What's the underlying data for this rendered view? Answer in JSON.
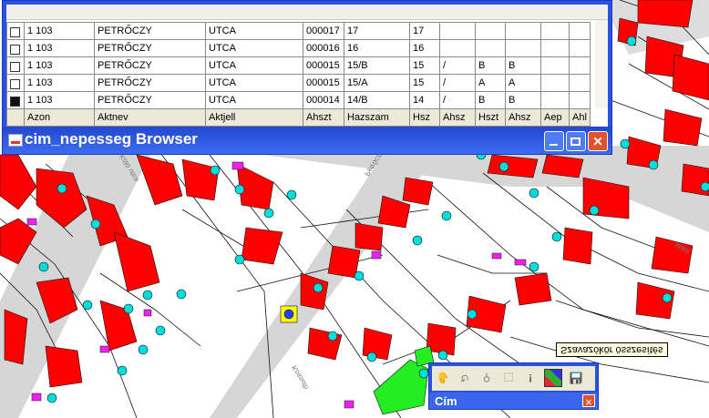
{
  "browser": {
    "title": "cim_nepesseg Browser",
    "columns": [
      "",
      "Azon",
      "Aktnev",
      "Aktjell",
      "Ahszt",
      "Hazszam",
      "Hsz",
      "Ahsz",
      "Hszt",
      "Ahsz",
      "Aep",
      "Ahl"
    ],
    "rows": [
      {
        "checked": true,
        "cells": [
          "1 103",
          "PETRŐCZY",
          "UTCA",
          "000014",
          "14/B",
          "14",
          "/",
          "B",
          "B",
          "",
          ""
        ]
      },
      {
        "checked": false,
        "cells": [
          "1 103",
          "PETRŐCZY",
          "UTCA",
          "000015",
          "15/A",
          "15",
          "/",
          "A",
          "A",
          "",
          ""
        ]
      },
      {
        "checked": false,
        "cells": [
          "1 103",
          "PETRŐCZY",
          "UTCA",
          "000015",
          "15/B",
          "15",
          "/",
          "B",
          "B",
          "",
          ""
        ]
      },
      {
        "checked": false,
        "cells": [
          "1 103",
          "PETRŐCZY",
          "UTCA",
          "000016",
          "16",
          "16",
          "",
          "",
          "",
          "",
          ""
        ]
      },
      {
        "checked": false,
        "cells": [
          "1 103",
          "PETRŐCZY",
          "UTCA",
          "000017",
          "17",
          "17",
          "",
          "",
          "",
          "",
          ""
        ]
      }
    ]
  },
  "cim": {
    "title": "Cím",
    "tools": [
      "pan-tool-icon",
      "rotate-tool-icon",
      "identify-tool-icon",
      "select-tool-icon",
      "info-tool-icon",
      "color-tool-icon",
      "save-tool-icon"
    ]
  },
  "tooltip": "Szavazókör összesítés",
  "streets": {
    "kolo": "Kölö utca",
    "petro": "Petrőczy",
    "kossu": "Kossuth",
    "mate": "Máté"
  },
  "colors": {
    "building": "#ff0000",
    "point": "#00dddd",
    "road": "#d9d9d9",
    "selected_highlight": "#ffff00",
    "green": "#22ee22",
    "magenta": "#ee22ee",
    "title_blue": "#2a54e0"
  }
}
